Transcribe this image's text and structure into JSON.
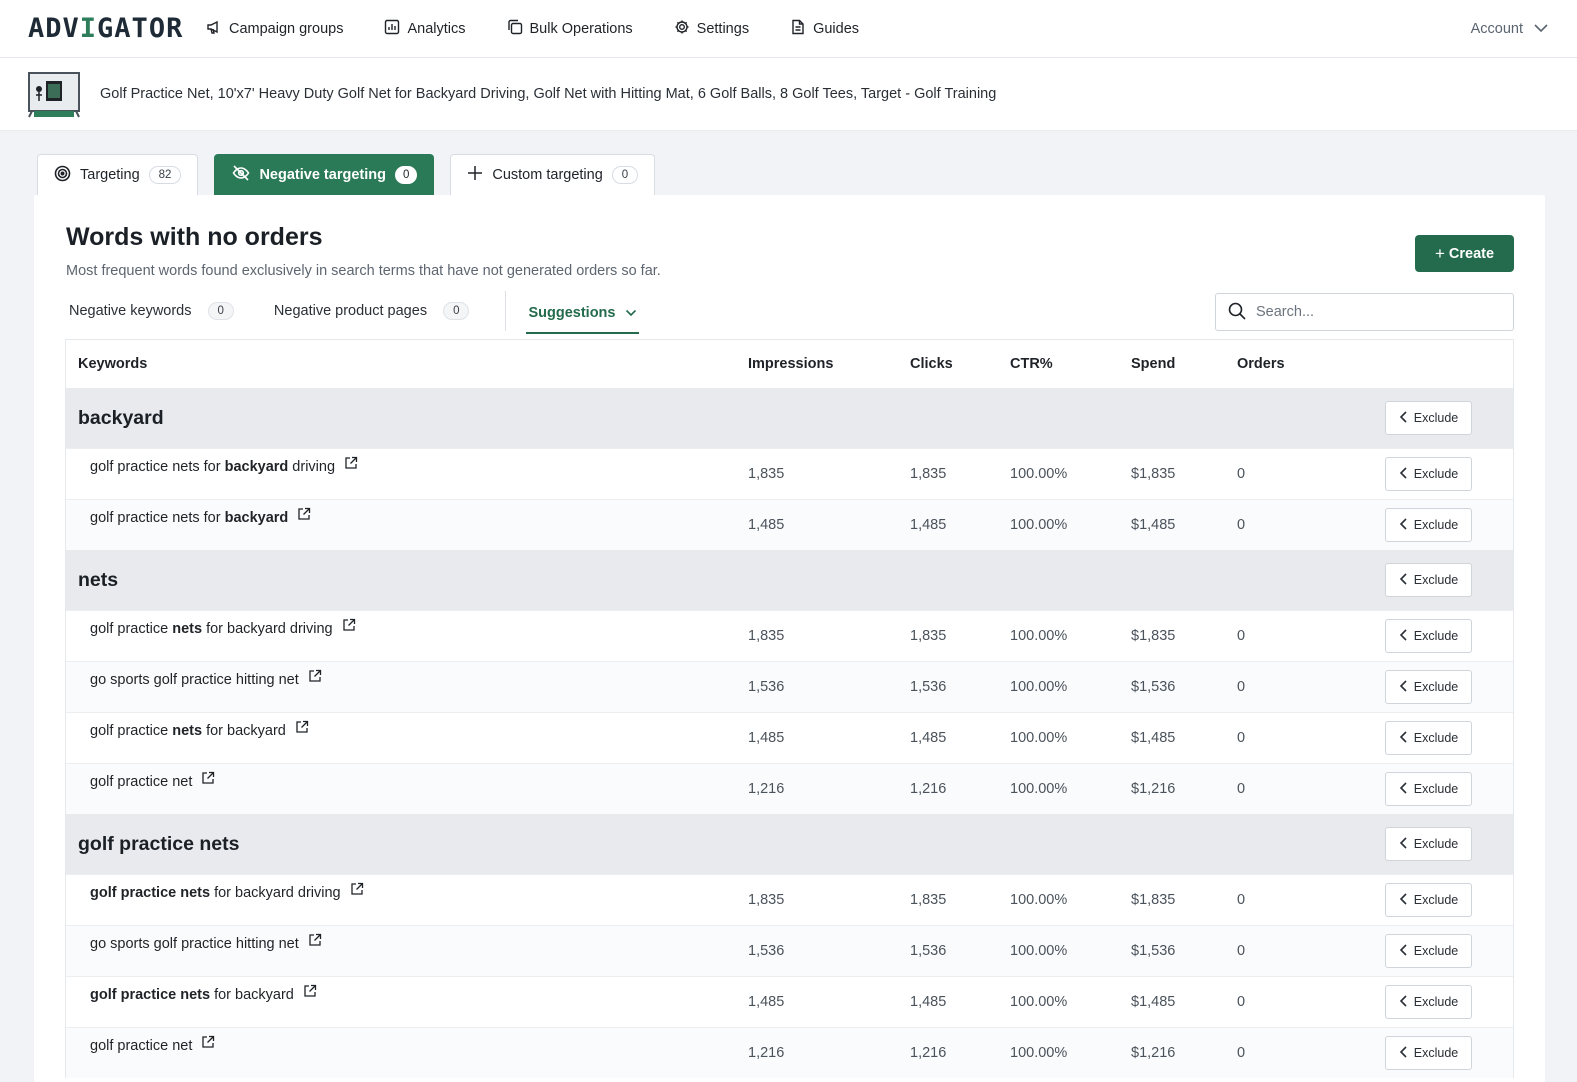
{
  "nav": {
    "logo_left": "ADV",
    "logo_mid": "I",
    "logo_right": "GATOR",
    "items": [
      {
        "label": "Campaign groups",
        "icon": "megaphone-icon"
      },
      {
        "label": "Analytics",
        "icon": "chart-icon"
      },
      {
        "label": "Bulk Operations",
        "icon": "copy-icon"
      },
      {
        "label": "Settings",
        "icon": "gear-icon"
      },
      {
        "label": "Guides",
        "icon": "document-icon"
      }
    ],
    "account": "Account"
  },
  "product": {
    "title": "Golf Practice Net, 10'x7' Heavy Duty Golf Net for Backyard Driving, Golf Net with Hitting Mat, 6 Golf Balls, 8 Golf Tees, Target - Golf Training"
  },
  "tabs": [
    {
      "label": "Targeting",
      "count": "82"
    },
    {
      "label": "Negative targeting",
      "count": "0"
    },
    {
      "label": "Custom targeting",
      "count": "0"
    }
  ],
  "section": {
    "title": "Words with no orders",
    "subtitle": "Most frequent words found exclusively in search terms that have not generated orders so far.",
    "create_label": "Create"
  },
  "subtabs": [
    {
      "label": "Negative keywords",
      "count": "0"
    },
    {
      "label": "Negative product pages",
      "count": "0"
    },
    {
      "label": "Suggestions"
    }
  ],
  "search": {
    "placeholder": "Search..."
  },
  "table": {
    "headers": {
      "keywords": "Keywords",
      "impressions": "Impressions",
      "clicks": "Clicks",
      "ctr": "CTR%",
      "spend": "Spend",
      "orders": "Orders"
    },
    "exclude_label": "Exclude",
    "groups": [
      {
        "name": "backyard",
        "rows": [
          {
            "pre": "golf practice nets for ",
            "bold": "backyard",
            "post": " driving",
            "impressions": "1,835",
            "clicks": "1,835",
            "ctr": "100.00%",
            "spend": "$1,835",
            "orders": "0"
          },
          {
            "pre": "golf practice nets for ",
            "bold": "backyard",
            "post": "",
            "impressions": "1,485",
            "clicks": "1,485",
            "ctr": "100.00%",
            "spend": "$1,485",
            "orders": "0"
          }
        ]
      },
      {
        "name": "nets",
        "rows": [
          {
            "pre": "golf practice ",
            "bold": "nets",
            "post": " for backyard driving",
            "impressions": "1,835",
            "clicks": "1,835",
            "ctr": "100.00%",
            "spend": "$1,835",
            "orders": "0"
          },
          {
            "pre": "go sports golf practice hitting net",
            "bold": "",
            "post": "",
            "impressions": "1,536",
            "clicks": "1,536",
            "ctr": "100.00%",
            "spend": "$1,536",
            "orders": "0"
          },
          {
            "pre": "golf practice ",
            "bold": "nets",
            "post": " for backyard",
            "impressions": "1,485",
            "clicks": "1,485",
            "ctr": "100.00%",
            "spend": "$1,485",
            "orders": "0"
          },
          {
            "pre": "golf practice net",
            "bold": "",
            "post": "",
            "impressions": "1,216",
            "clicks": "1,216",
            "ctr": "100.00%",
            "spend": "$1,216",
            "orders": "0"
          }
        ]
      },
      {
        "name": "golf practice nets",
        "rows": [
          {
            "pre": "",
            "bold": "golf practice nets",
            "post": " for backyard driving",
            "impressions": "1,835",
            "clicks": "1,835",
            "ctr": "100.00%",
            "spend": "$1,835",
            "orders": "0"
          },
          {
            "pre": "go sports golf practice hitting net",
            "bold": "",
            "post": "",
            "impressions": "1,536",
            "clicks": "1,536",
            "ctr": "100.00%",
            "spend": "$1,536",
            "orders": "0"
          },
          {
            "pre": "",
            "bold": "golf practice nets",
            "post": " for backyard",
            "impressions": "1,485",
            "clicks": "1,485",
            "ctr": "100.00%",
            "spend": "$1,485",
            "orders": "0"
          },
          {
            "pre": "golf practice net",
            "bold": "",
            "post": "",
            "impressions": "1,216",
            "clicks": "1,216",
            "ctr": "100.00%",
            "spend": "$1,216",
            "orders": "0"
          }
        ]
      }
    ]
  }
}
